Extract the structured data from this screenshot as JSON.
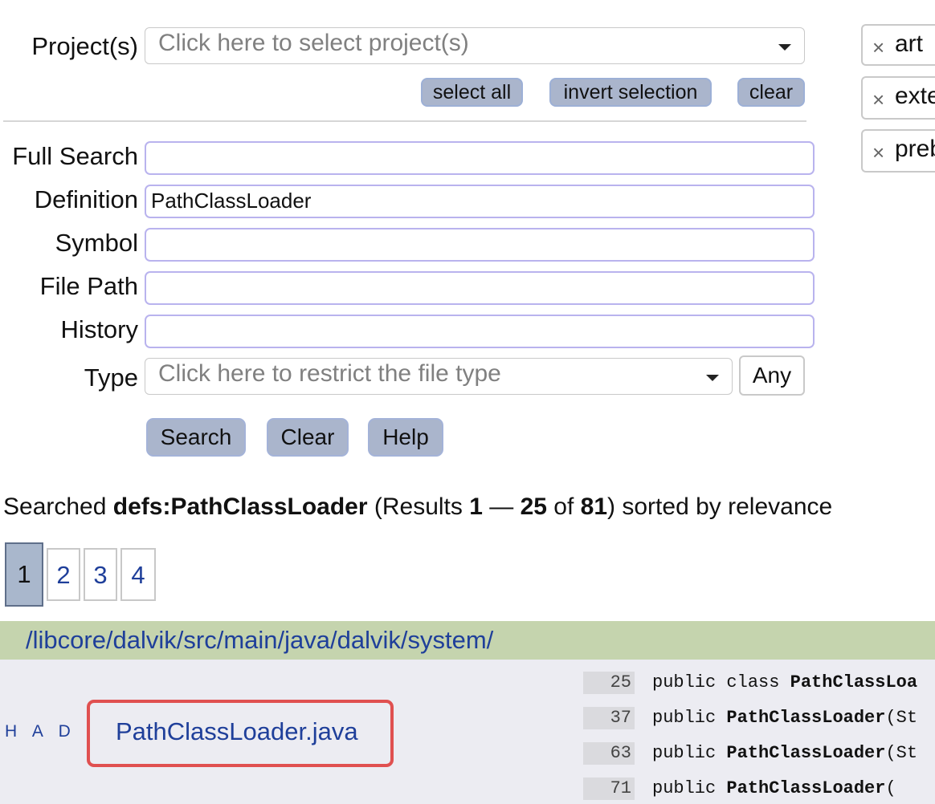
{
  "project": {
    "label": "Project(s)",
    "placeholder": "Click here to select project(s)",
    "buttons": {
      "select_all": "select all",
      "invert_selection": "invert selection",
      "clear": "clear"
    }
  },
  "selected_projects": [
    {
      "name": "art"
    },
    {
      "name": "exte"
    },
    {
      "name": "preb"
    }
  ],
  "form": {
    "full_search": {
      "label": "Full Search",
      "value": ""
    },
    "definition": {
      "label": "Definition",
      "value": "PathClassLoader"
    },
    "symbol": {
      "label": "Symbol",
      "value": ""
    },
    "file_path": {
      "label": "File Path",
      "value": ""
    },
    "history": {
      "label": "History",
      "value": ""
    },
    "type": {
      "label": "Type",
      "placeholder": "Click here to restrict the file type",
      "any_button": "Any"
    },
    "actions": {
      "search": "Search",
      "clear": "Clear",
      "help": "Help"
    }
  },
  "summary": {
    "prefix": "Searched ",
    "query": "defs:PathClassLoader",
    "results_open": " (Results ",
    "range_start": "1",
    "dash": " — ",
    "range_end": "25",
    "of": " of ",
    "total": "81",
    "suffix": ") sorted by relevance"
  },
  "pagination": {
    "current": "1",
    "pages": [
      "2",
      "3",
      "4"
    ]
  },
  "result_group": {
    "path": "/libcore/dalvik/src/main/java/dalvik/system/",
    "hist_links": {
      "h": "H",
      "a": "A",
      "d": "D"
    },
    "file": "PathClassLoader.java",
    "lines": [
      {
        "num": "25",
        "pre": "public class ",
        "bold": "PathClassLoa",
        "post": ""
      },
      {
        "num": "37",
        "pre": "public ",
        "bold": "PathClassLoader",
        "post": "(St"
      },
      {
        "num": "63",
        "pre": "public ",
        "bold": "PathClassLoader",
        "post": "(St"
      },
      {
        "num": "71",
        "pre": "public ",
        "bold": "PathClassLoader",
        "post": "("
      }
    ]
  },
  "colors": {
    "button_bg": "#aab5cc",
    "input_border": "#b9b3ee",
    "path_bar": "#c5d4ae",
    "results_bg": "#ececf2",
    "link": "#1f3f9a",
    "highlight_box": "#e05050"
  },
  "icons": {
    "dropdown": "caret-down-icon",
    "remove_tag": "close-x-icon"
  }
}
